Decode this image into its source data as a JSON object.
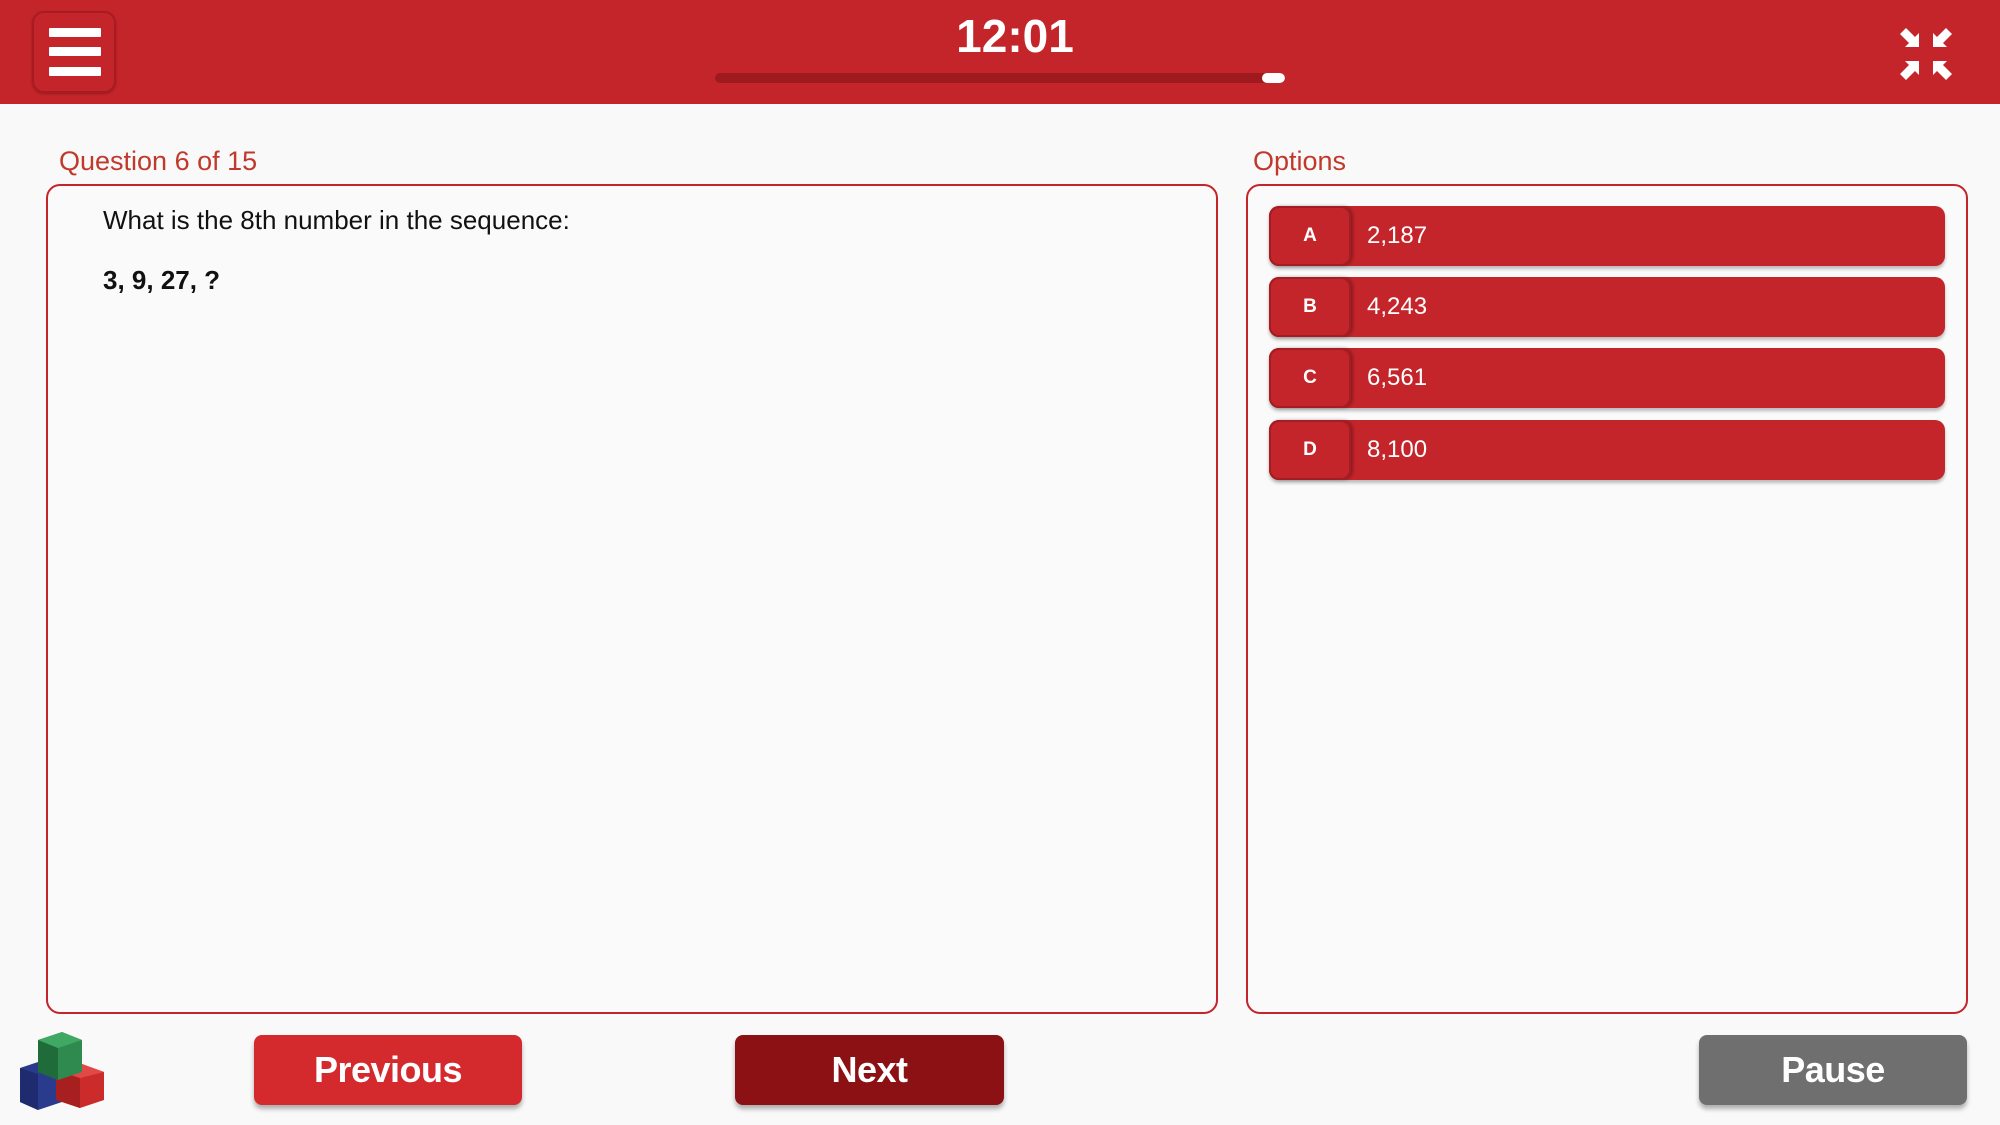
{
  "header": {
    "timer": "12:01",
    "timer_progress_remaining": 0.04,
    "menu_icon": "hamburger-menu-icon",
    "fullscreen_icon": "exit-fullscreen-icon"
  },
  "question": {
    "label": "Question 6 of 15",
    "text": "What is the 8th number in the sequence:",
    "sequence": "3, 9, 27, ?"
  },
  "options": {
    "label": "Options",
    "items": [
      {
        "letter": "A",
        "value": "2,187"
      },
      {
        "letter": "B",
        "value": "4,243"
      },
      {
        "letter": "C",
        "value": "6,561"
      },
      {
        "letter": "D",
        "value": "8,100"
      }
    ]
  },
  "footer": {
    "logo_icon": "color-cubes-logo-icon",
    "previous_label": "Previous",
    "next_label": "Next",
    "pause_label": "Pause"
  },
  "colors": {
    "primary": "#c4252a",
    "next_button": "#8c1115",
    "pause_button": "#6f6f6f",
    "label_text": "#c0392b"
  }
}
